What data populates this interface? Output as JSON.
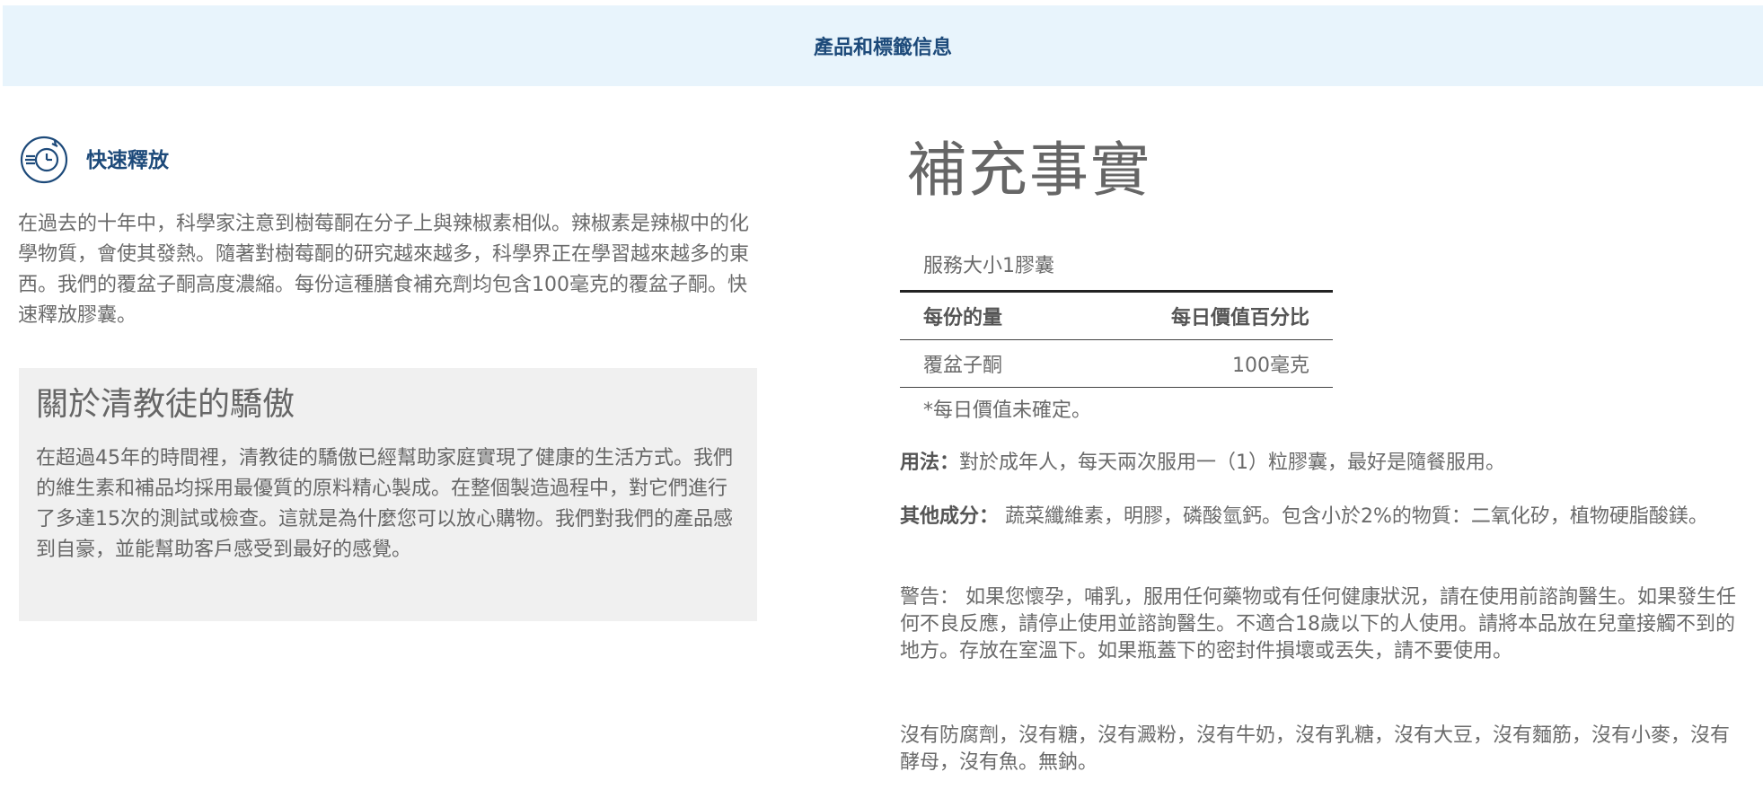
{
  "header": {
    "title": "產品和標籤信息"
  },
  "release": {
    "label": "快速釋放",
    "icon": "timer-release-icon"
  },
  "intro": {
    "text": "在過去的十年中，科學家注意到樹莓酮在分子上與辣椒素相似。辣椒素是辣椒中的化學物質，會使其發熱。隨著對樹莓酮的研究越來越多，科學界正在學習越來越多的東西。我們的覆盆子酮高度濃縮。每份這種膳食補充劑均包含100毫克的覆盆子酮。快速釋放膠囊。"
  },
  "about": {
    "title": "關於清教徒的驕傲",
    "text": "在超過45年的時間裡，清教徒的驕傲已經幫助家庭實現了健康的生活方式。我們的維生素和補品均採用最優質的原料精心製成。在整個製造過程中，對它們進行了多達15次的測試或檢查。這就是為什麼您可以放心購物。我們對我們的產品感到自豪，並能幫助客戶感受到最好的感覺。"
  },
  "facts": {
    "title": "補充事實",
    "serving": "服務大小1膠囊",
    "header_left": "每份的量",
    "header_right": "每日價值百分比",
    "ingredient_name": "覆盆子酮",
    "ingredient_amount": "100毫克",
    "note": "*每日價值未確定。"
  },
  "usage": {
    "label": "用法：",
    "text": "對於成年人，每天兩次服用一（1）粒膠囊，最好是隨餐服用。"
  },
  "other": {
    "label": "其他成分：",
    "text": " 蔬菜纖維素，明膠，磷酸氫鈣。包含小於2%的物質：二氧化矽，植物硬脂酸鎂。"
  },
  "warning": {
    "text": "警告： 如果您懷孕，哺乳，服用任何藥物或有任何健康狀況，請在使用前諮詢醫生。如果發生任何不良反應，請停止使用並諮詢醫生。不適合18歲以下的人使用。請將本品放在兒童接觸不到的地方。存放在室溫下。如果瓶蓋下的密封件損壞或丟失，請不要使用。"
  },
  "free_from": {
    "text": "沒有防腐劑，沒有糖，沒有澱粉，沒有牛奶，沒有乳糖，沒有大豆，沒有麵筋，沒有小麥，沒有酵母，沒有魚。無鈉。"
  },
  "colors": {
    "header_bg": "#e8f4fc",
    "accent": "#1d4a7a",
    "box_bg": "#f0f0f0"
  }
}
